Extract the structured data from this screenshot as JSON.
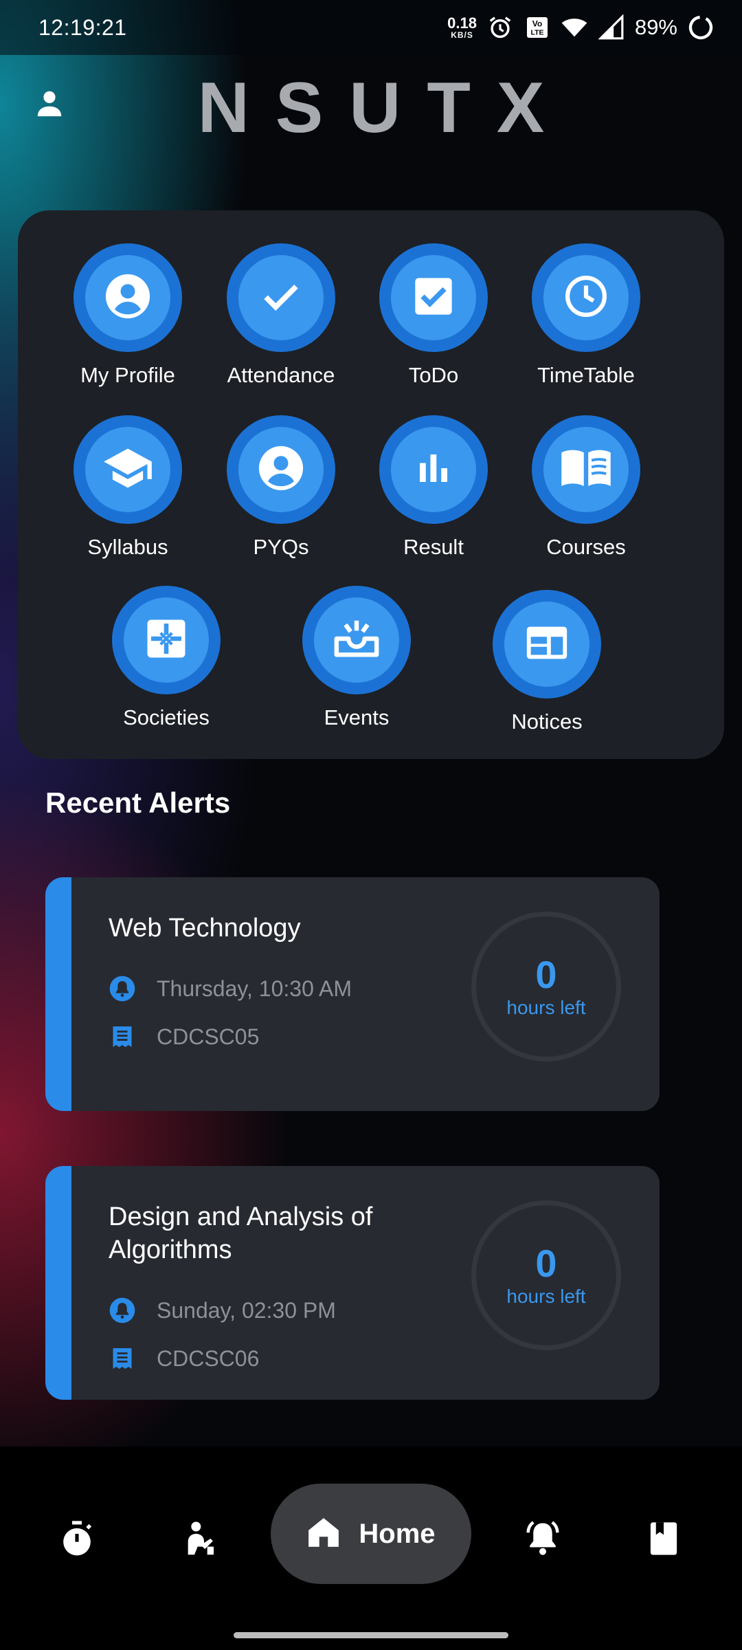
{
  "status_bar": {
    "time": "12:19:21",
    "net_speed_value": "0.18",
    "net_speed_unit": "KB/S",
    "battery_percent": "89%",
    "icons": [
      "alarm-icon",
      "volte-icon",
      "wifi-icon",
      "signal-icon",
      "battery-ring-icon"
    ]
  },
  "header": {
    "title": "NSUTX",
    "profile_icon": "person-icon"
  },
  "grid": {
    "tiles": [
      {
        "label": "My Profile",
        "icon": "account-circle-icon"
      },
      {
        "label": "Attendance",
        "icon": "check-icon"
      },
      {
        "label": "ToDo",
        "icon": "checkbox-icon"
      },
      {
        "label": "TimeTable",
        "icon": "clock-icon"
      },
      {
        "label": "Syllabus",
        "icon": "graduation-cap-icon"
      },
      {
        "label": "PYQs",
        "icon": "account-circle-icon"
      },
      {
        "label": "Result",
        "icon": "bar-chart-icon"
      },
      {
        "label": "Courses",
        "icon": "open-book-icon"
      },
      {
        "label": "Societies",
        "icon": "societies-icon"
      },
      {
        "label": "Events",
        "icon": "inbox-sparkle-icon"
      },
      {
        "label": "Notices",
        "icon": "web-panel-icon"
      }
    ]
  },
  "alerts": {
    "title": "Recent Alerts",
    "items": [
      {
        "subject": "Web Technology",
        "time": "Thursday, 10:30 AM",
        "code": "CDCSC05",
        "hours": "0",
        "hours_label": "hours left"
      },
      {
        "subject": "Design and Analysis of Algorithms",
        "time": "Sunday, 02:30 PM",
        "code": "CDCSC06",
        "hours": "0",
        "hours_label": "hours left"
      }
    ]
  },
  "bottom_nav": {
    "items": [
      "timer-icon",
      "person-study-icon",
      "home-icon",
      "bell-ring-icon",
      "bookmark-book-icon"
    ],
    "active_label": "Home"
  },
  "colors": {
    "accent": "#2a8be8",
    "tile_outer": "#1b72d4",
    "tile_inner": "#3a98ef",
    "card_bg": "#272a31",
    "grid_bg": "#1d2026"
  }
}
